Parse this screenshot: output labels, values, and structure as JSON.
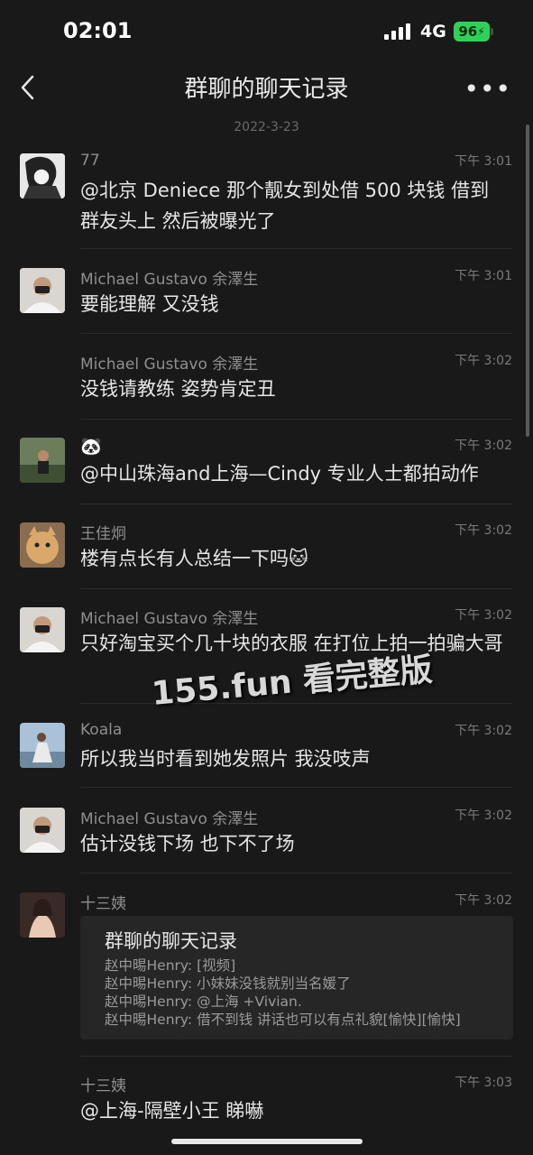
{
  "status": {
    "time": "02:01",
    "network": "4G",
    "battery": "96"
  },
  "nav": {
    "title": "群聊的聊天记录"
  },
  "date": "2022-3-23",
  "messages": [
    {
      "name": "77",
      "time": "下午 3:01",
      "text": "@北京 Deniece 那个靓女到处借 500 块钱 借到群友头上 然后被曝光了"
    },
    {
      "name": "Michael Gustavo 余澤生",
      "time": "下午 3:01",
      "text": "要能理解 又没钱"
    },
    {
      "name": "Michael Gustavo 余澤生",
      "time": "下午 3:02",
      "text": "没钱请教练 姿势肯定丑"
    },
    {
      "name": "🐼",
      "time": "下午 3:02",
      "text": "@中山珠海and上海—Cindy 专业人士都拍动作"
    },
    {
      "name": "王佳炯",
      "time": "下午 3:02",
      "text": "楼有点长有人总结一下吗🐱"
    },
    {
      "name": "Michael Gustavo 余澤生",
      "time": "下午 3:02",
      "text": "只好淘宝买个几十块的衣服 在打位上拍一拍骗大哥"
    },
    {
      "name": "Koala",
      "time": "下午 3:02",
      "text": "所以我当时看到她发照片  我没吱声"
    },
    {
      "name": "Michael Gustavo 余澤生",
      "time": "下午 3:02",
      "text": "估计没钱下场 也下不了场"
    },
    {
      "name": "十三姨",
      "time": "下午 3:02",
      "card": {
        "title": "群聊的聊天记录",
        "lines": [
          "赵中晹Henry: [视频]",
          "赵中晹Henry: 小妹妹没钱就别当名媛了",
          "赵中晹Henry: @上海 +Vivian.",
          "赵中晹Henry: 借不到钱 讲话也可以有点礼貌[愉快][愉快]"
        ]
      }
    },
    {
      "name": "十三姨",
      "time": "下午 3:03",
      "text": "@上海-隔壁小王 睇嚇"
    }
  ],
  "watermark": "155.fun 看完整版"
}
